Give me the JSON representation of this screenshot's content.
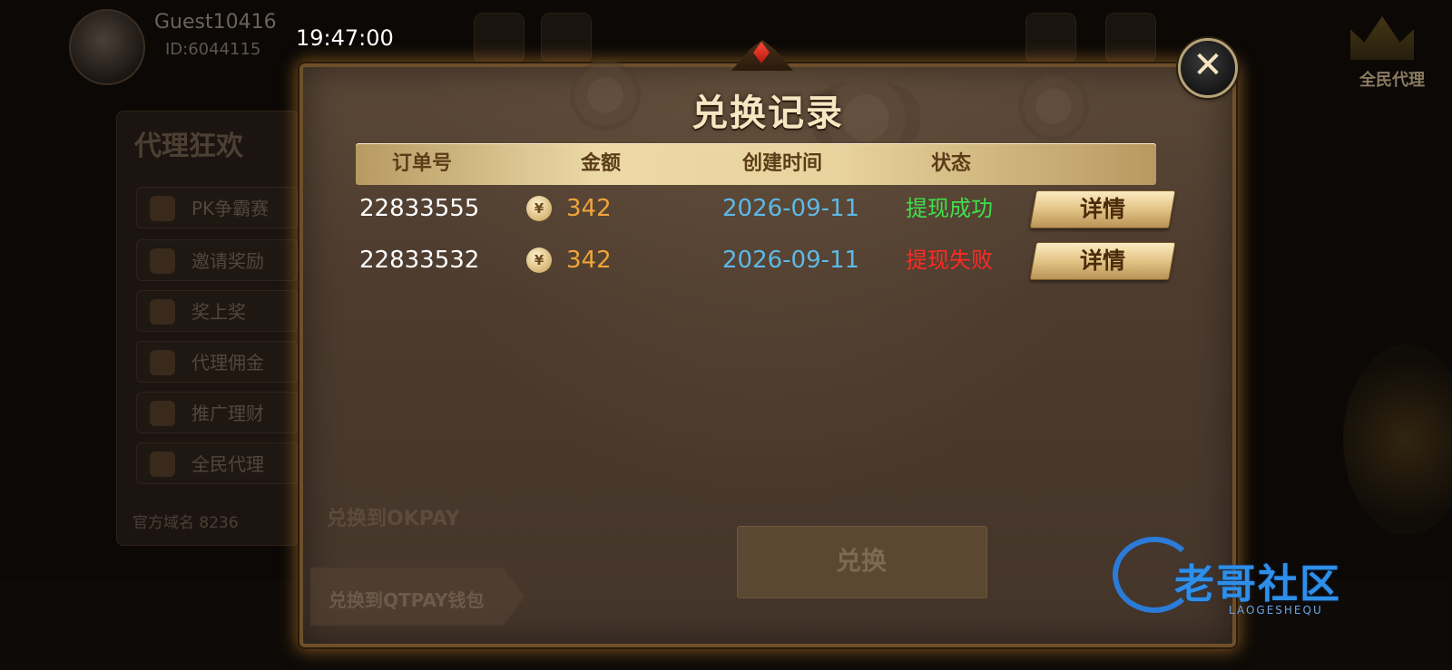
{
  "status_bar": {
    "clock": "19:47:00"
  },
  "background": {
    "username": "Guest10416",
    "user_id": "ID:6044115",
    "crown_label": "全民代理",
    "panel_title": "代理狂欢",
    "menu_items": [
      "PK争霸赛",
      "邀请奖励",
      "奖上奖",
      "代理佣金",
      "推广理财",
      "全民代理"
    ],
    "domain_text": "官方域名 8236",
    "okpay_label": "兑换到OKPAY",
    "qtpay_label": "兑换到QTPAY钱包",
    "exchange_button": "兑换"
  },
  "modal": {
    "title": "兑换记录",
    "close_symbol": "✕",
    "columns": [
      "订单号",
      "金额",
      "创建时间",
      "状态"
    ],
    "coin_symbol": "¥",
    "rows": [
      {
        "order": "22833555",
        "amount": "342",
        "date": "2026-09-11",
        "status": "提现成功",
        "status_type": "success",
        "action": "详情"
      },
      {
        "order": "22833532",
        "amount": "342",
        "date": "2026-09-11",
        "status": "提现失败",
        "status_type": "failed",
        "action": "详情"
      }
    ]
  },
  "watermark": {
    "text": "老哥社区",
    "subtext": "LAOGESHEQU"
  },
  "colors": {
    "success": "#3ee04a",
    "failed": "#ff2a24",
    "amount": "#f0a43a",
    "date": "#5db9e6",
    "header_gold": "#e9d39e"
  }
}
